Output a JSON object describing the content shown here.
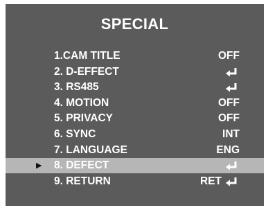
{
  "title": "SPECIAL",
  "selected_index": 7,
  "items": [
    {
      "label": "1.CAM TITLE",
      "value": "OFF",
      "enter_icon": false
    },
    {
      "label": "2. D-EFFECT",
      "value": "",
      "enter_icon": true
    },
    {
      "label": "3. RS485",
      "value": "",
      "enter_icon": true
    },
    {
      "label": "4. MOTION",
      "value": "OFF",
      "enter_icon": false
    },
    {
      "label": "5. PRIVACY",
      "value": "OFF",
      "enter_icon": false
    },
    {
      "label": "6. SYNC",
      "value": "INT",
      "enter_icon": false
    },
    {
      "label": "7. LANGUAGE",
      "value": "ENG",
      "enter_icon": false
    },
    {
      "label": "8. DEFECT",
      "value": "",
      "enter_icon": true
    },
    {
      "label": "9. RETURN",
      "value": "RET",
      "enter_icon": true
    }
  ],
  "icons": {
    "pointer": "▶",
    "enter": "enter-arrow-icon"
  },
  "colors": {
    "panel_background": "#5b5b5b",
    "selected_row_background": "#b6b6b6",
    "text": "#ffffff",
    "pointer": "#111111"
  }
}
